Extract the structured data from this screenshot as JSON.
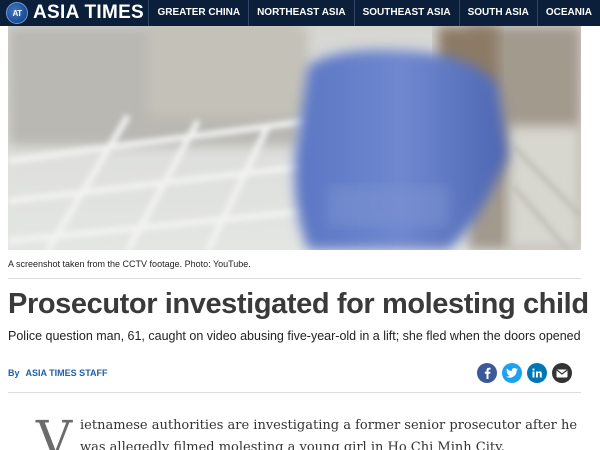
{
  "site": {
    "logo_mark": "AT",
    "logo_text": "ASIA TIMES"
  },
  "nav": {
    "items": [
      "GREATER CHINA",
      "NORTHEAST ASIA",
      "SOUTHEAST ASIA",
      "SOUTH ASIA",
      "OCEANIA"
    ]
  },
  "article": {
    "photo_caption": "A screenshot taken from the CCTV footage. Photo: YouTube.",
    "headline": "Prosecutor investigated for molesting child",
    "dek": "Police question man, 61, caught on video abusing five-year-old in a lift; she fled when the doors opened",
    "byline_prefix": "By",
    "byline_author": "ASIA TIMES STAFF",
    "dropcap": "V",
    "body_line1": "ietnamese authorities are investigating a former senior prosecutor after he",
    "body_line2": "was allegedly filmed molesting a young girl in Ho Chi Minh City."
  },
  "share": {
    "icons": [
      "facebook-icon",
      "twitter-icon",
      "linkedin-icon",
      "email-icon"
    ],
    "colors": {
      "facebook": "#3b5998",
      "twitter": "#1da1f2",
      "linkedin": "#0077b5",
      "email": "#333333"
    }
  },
  "colors": {
    "topbar": "#0b1f3a",
    "byline": "#1f5fa8",
    "headline": "#3a3a3a"
  }
}
